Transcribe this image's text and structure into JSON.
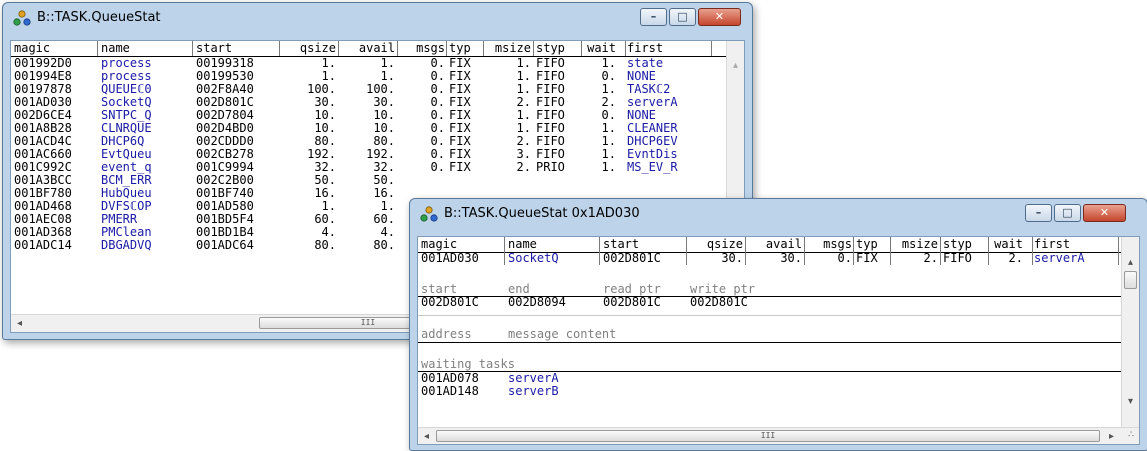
{
  "win1": {
    "title": "B::TASK.QueueStat",
    "headers": [
      "magic",
      "name",
      "start",
      "qsize",
      "avail",
      "msgs",
      "typ",
      "msize",
      "styp",
      "wait",
      "first"
    ],
    "rows": [
      [
        "001992D0",
        "process",
        "00199318",
        "1.",
        "1.",
        "0.",
        "FIX",
        "1.",
        "FIFO",
        "1.",
        "state"
      ],
      [
        "001994E8",
        "process",
        "00199530",
        "1.",
        "1.",
        "0.",
        "FIX",
        "1.",
        "FIFO",
        "0.",
        "NONE"
      ],
      [
        "00197878",
        "QUEUEℂ0",
        "002F8A40",
        "100.",
        "100.",
        "0.",
        "FIX",
        "1.",
        "FIFO",
        "1.",
        "TASKℂ2"
      ],
      [
        "001AD030",
        "SocketQ",
        "002D801C",
        "30.",
        "30.",
        "0.",
        "FIX",
        "2.",
        "FIFO",
        "2.",
        "serverA"
      ],
      [
        "002D6CE4",
        "SNTPC_Q",
        "002D7804",
        "10.",
        "10.",
        "0.",
        "FIX",
        "1.",
        "FIFO",
        "0.",
        "NONE"
      ],
      [
        "001A8B28",
        "CLNRQUE",
        "002D4BD0",
        "10.",
        "10.",
        "0.",
        "FIX",
        "1.",
        "FIFO",
        "1.",
        "CLEANER"
      ],
      [
        "001ACD4C",
        "DHCP6Q",
        "002CDDD0",
        "80.",
        "80.",
        "0.",
        "FIX",
        "2.",
        "FIFO",
        "1.",
        "DHCP6EV"
      ],
      [
        "001AC660",
        "EvtQueu",
        "002CB278",
        "192.",
        "192.",
        "0.",
        "FIX",
        "3.",
        "FIFO",
        "1.",
        "EvntDis"
      ],
      [
        "001C992C",
        "event_q",
        "001C9994",
        "32.",
        "32.",
        "0.",
        "FIX",
        "2.",
        "PRIO",
        "1.",
        "MS_EV_R"
      ],
      [
        "001A3BCC",
        "BCM_ERR",
        "002C2B00",
        "50.",
        "50.",
        "",
        "",
        "",
        "",
        "",
        ""
      ],
      [
        "001BF780",
        "HubQueu",
        "001BF740",
        "16.",
        "16.",
        "",
        "",
        "",
        "",
        "",
        ""
      ],
      [
        "001AD468",
        "DVFSℂOP",
        "001AD580",
        "1.",
        "1.",
        "",
        "",
        "",
        "",
        "",
        ""
      ],
      [
        "001AEC08",
        "PMERR",
        "001BD5F4",
        "60.",
        "60.",
        "",
        "",
        "",
        "",
        "",
        ""
      ],
      [
        "001AD368",
        "PMClean",
        "001BD1B4",
        "4.",
        "4.",
        "",
        "",
        "",
        "",
        "",
        ""
      ],
      [
        "001ADC14",
        "DBGADVQ",
        "001ADC64",
        "80.",
        "80.",
        "",
        "",
        "",
        "",
        "",
        ""
      ]
    ],
    "scroll_left": "◂",
    "scroll_thumb": "III"
  },
  "win2": {
    "title": "B::TASK.QueueStat 0x1AD030",
    "headers": [
      "magic",
      "name",
      "start",
      "qsize",
      "avail",
      "msgs",
      "typ",
      "msize",
      "styp",
      "wait",
      "first"
    ],
    "row": [
      "001AD030",
      "SocketQ",
      "002D801C",
      "30.",
      "30.",
      "0.",
      "FIX",
      "2.",
      "FIFO",
      "2.",
      "serverA"
    ],
    "buffer_headers": [
      "start",
      "end",
      "read ptr",
      "write ptr"
    ],
    "buffer_values": [
      "002D801C",
      "002D8094",
      "002D801C",
      "002D801C"
    ],
    "message_headers": [
      "address",
      "message content"
    ],
    "waiting_header": "waiting tasks",
    "waiting": [
      {
        "magic": "001AD078",
        "name": "serverA"
      },
      {
        "magic": "001AD148",
        "name": "serverB"
      }
    ],
    "scroll_left": "◂",
    "scroll_right": "▸",
    "scroll_up": "▴",
    "scroll_down": "▾",
    "scroll_thumb": "III",
    "grip": "∴"
  },
  "controls": {
    "minimize": "–",
    "maximize": "□",
    "close": "✕"
  }
}
